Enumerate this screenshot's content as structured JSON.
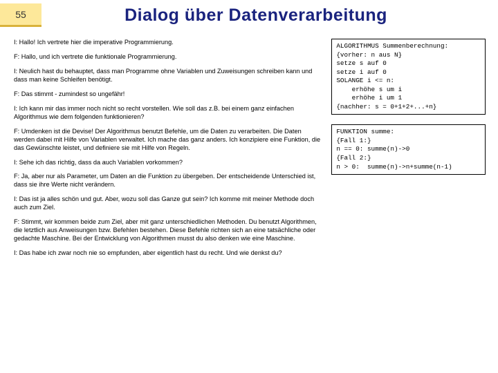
{
  "slide_number": "55",
  "title": "Dialog über Datenverarbeitung",
  "dialog": [
    "I: Hallo! Ich vertrete hier die imperative Programmierung.",
    "F: Hallo, und ich vertrete die funktionale Programmierung.",
    "I: Neulich hast du behauptet, dass man Programme ohne Variablen und Zuweisungen schreiben kann und dass man keine Schleifen benötigt.",
    "F: Das stimmt - zumindest so ungefähr!",
    "I: Ich kann mir das immer noch nicht so recht vorstellen. Wie soll das z.B. bei einem ganz einfachen Algorithmus wie dem folgenden funktionieren?",
    "F: Umdenken ist die Devise! Der Algorithmus benutzt Befehle, um die Daten zu verarbeiten. Die Daten werden dabei mit Hilfe von Variablen verwaltet. Ich mache das ganz anders. Ich konzipiere eine Funktion, die das Gewünschte leistet, und definiere sie mit Hilfe von Regeln.",
    "I: Sehe ich das richtig, dass da auch Variablen vorkommen?",
    "F: Ja, aber nur als Parameter, um Daten an die Funktion zu übergeben. Der entscheidende Unterschied ist, dass sie ihre Werte nicht verändern.",
    "I: Das ist ja alles schön und gut. Aber, wozu soll das Ganze gut sein? Ich komme mit meiner Methode doch auch zum Ziel.",
    "F: Stimmt, wir kommen beide zum Ziel, aber mit ganz unterschiedlichen Methoden. Du benutzt Algorithmen, die letztlich aus Anweisungen bzw. Befehlen bestehen. Diese Befehle richten sich an eine tatsächliche oder gedachte Maschine. Bei der Entwicklung von Algorithmen musst du also denken wie eine Maschine.",
    "I: Das habe ich zwar noch nie so empfunden, aber eigentlich hast du recht. Und wie denkst du?"
  ],
  "code_box_1": "ALGORITHMUS Summenberechnung:\n{vorher: n aus N}\nsetze s auf 0\nsetze i auf 0\nSOLANGE i <= n:\n    erhöhe s um i\n    erhöhe i um 1\n{nachher: s = 0+1+2+...+n}",
  "code_box_2": "FUNKTION summe:\n{Fall 1:}\nn == 0: summe(n)->0\n{Fall 2:}\nn > 0:  summe(n)->n+summe(n-1)"
}
